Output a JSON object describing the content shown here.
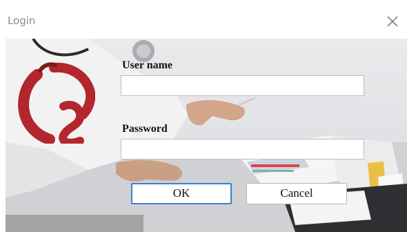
{
  "window": {
    "title": "Login"
  },
  "form": {
    "username_label": "User name",
    "username_value": "",
    "password_label": "Password",
    "password_value": ""
  },
  "buttons": {
    "ok_label": "OK",
    "cancel_label": "Cancel"
  },
  "colors": {
    "logo_red": "#b3262d",
    "default_button_border": "#3b7fd0"
  },
  "icons": {
    "close": "close-icon",
    "logo": "brand-logo"
  }
}
